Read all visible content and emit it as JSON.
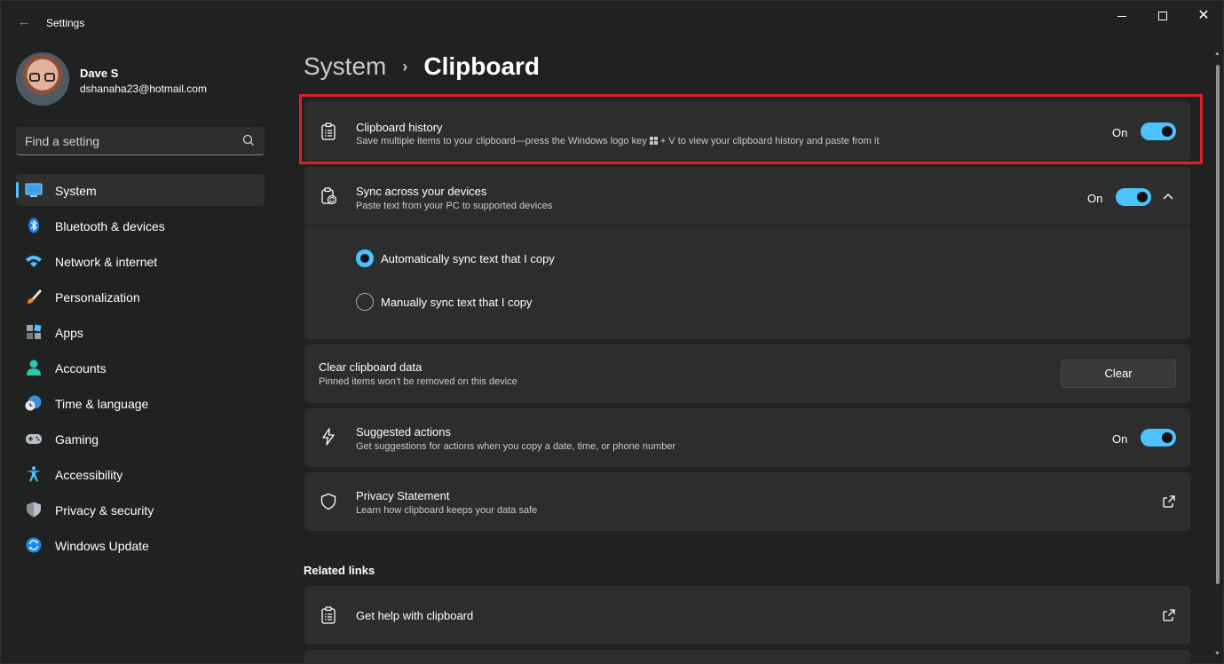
{
  "window": {
    "title": "Settings"
  },
  "profile": {
    "name": "Dave S",
    "email": "dshanaha23@hotmail.com"
  },
  "search": {
    "placeholder": "Find a setting"
  },
  "nav": [
    {
      "label": "System",
      "icon": "monitor-icon",
      "active": true
    },
    {
      "label": "Bluetooth & devices",
      "icon": "bluetooth-icon"
    },
    {
      "label": "Network & internet",
      "icon": "wifi-icon"
    },
    {
      "label": "Personalization",
      "icon": "brush-icon"
    },
    {
      "label": "Apps",
      "icon": "apps-icon"
    },
    {
      "label": "Accounts",
      "icon": "person-icon"
    },
    {
      "label": "Time & language",
      "icon": "globe-clock-icon"
    },
    {
      "label": "Gaming",
      "icon": "gamepad-icon"
    },
    {
      "label": "Accessibility",
      "icon": "accessibility-icon"
    },
    {
      "label": "Privacy & security",
      "icon": "shield-icon"
    },
    {
      "label": "Windows Update",
      "icon": "update-icon"
    }
  ],
  "breadcrumb": {
    "parent": "System",
    "separator": "›",
    "current": "Clipboard"
  },
  "cards": {
    "history": {
      "title": "Clipboard history",
      "subtitle_pre": "Save multiple items to your clipboard—press the Windows logo key ",
      "subtitle_post": " + V to view your clipboard history and paste from it",
      "state": "On"
    },
    "sync": {
      "title": "Sync across your devices",
      "subtitle": "Paste text from your PC to supported devices",
      "state": "On"
    },
    "sync_options": [
      {
        "label": "Automatically sync text that I copy",
        "selected": true
      },
      {
        "label": "Manually sync text that I copy",
        "selected": false
      }
    ],
    "clear": {
      "title": "Clear clipboard data",
      "subtitle": "Pinned items won’t be removed on this device",
      "button": "Clear"
    },
    "suggested": {
      "title": "Suggested actions",
      "subtitle": "Get suggestions for actions when you copy a date, time, or phone number",
      "state": "On"
    },
    "privacy": {
      "title": "Privacy Statement",
      "subtitle": "Learn how clipboard keeps your data safe"
    }
  },
  "related": {
    "heading": "Related links",
    "help": "Get help with clipboard"
  },
  "colors": {
    "accent": "#4cc2ff",
    "highlight": "#e0202b",
    "background": "#1f2221",
    "card": "#2b2e2d"
  }
}
